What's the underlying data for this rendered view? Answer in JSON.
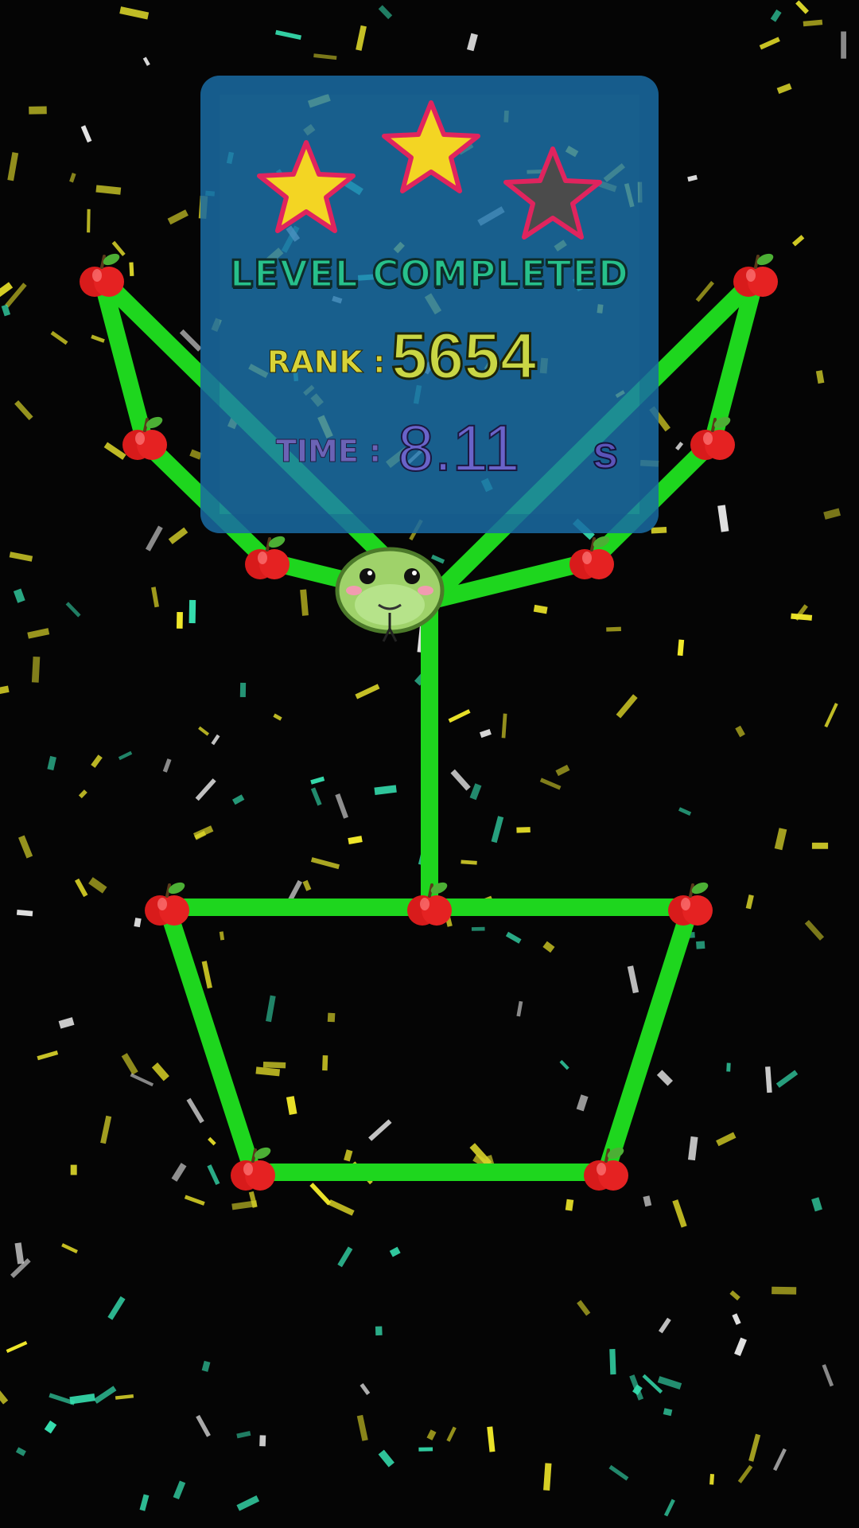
{
  "game": {
    "background_color": "#050505",
    "path_color": "#1ed61e",
    "node_icon": "apple-icon",
    "player_icon": "snake-head-icon"
  },
  "result_panel": {
    "title": "LEVEL COMPLETED",
    "stars_earned": 2,
    "stars_total": 3,
    "rank_label": "RANK :",
    "rank_value": "5654",
    "time_label": "TIME :",
    "time_value": "8.11",
    "time_unit": "s"
  },
  "colors": {
    "panel": "#1e78b4",
    "star_gold": "#f3d523",
    "star_gray": "#4b4b4b",
    "star_outline": "#e0245e",
    "title_green": "#27c08b",
    "rank_yellow": "#c9d645",
    "time_purple": "#6a63c9"
  }
}
